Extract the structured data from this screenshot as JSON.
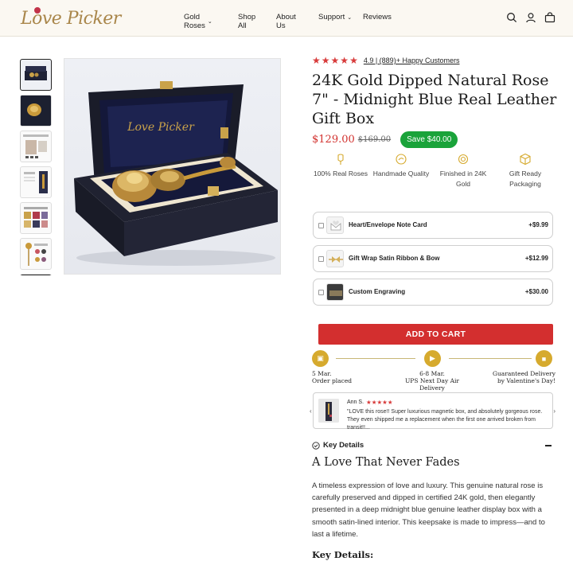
{
  "brand": {
    "logo_text": "Love Picker"
  },
  "nav": {
    "items": [
      {
        "label": "Gold Roses",
        "has_dropdown": true
      },
      {
        "label": "Shop All",
        "has_dropdown": false
      },
      {
        "label": "About Us",
        "has_dropdown": false
      },
      {
        "label": "Support",
        "has_dropdown": true
      },
      {
        "label": "Reviews",
        "has_dropdown": false
      }
    ],
    "icons": [
      "search-icon",
      "account-icon",
      "cart-icon"
    ]
  },
  "gallery": {
    "main_image": {
      "box_logo_text": "Love Picker"
    },
    "thumbnail_count": 7,
    "active_index": 0
  },
  "product": {
    "rating_value": "4.9",
    "rating_text": "4.9 | (889)+ Happy Customers",
    "star_count": 5,
    "title": "24K Gold Dipped Natural Rose 7\" - Midnight Blue Real Leather Gift Box",
    "price": "$129.00",
    "compare_price": "$169.00",
    "save_badge": "Save $40.00"
  },
  "features": [
    {
      "icon": "rose-icon",
      "label": "100% Real Roses"
    },
    {
      "icon": "handmade-icon",
      "label": "Handmade Quality"
    },
    {
      "icon": "gold-icon",
      "label": "Finished in 24K Gold"
    },
    {
      "icon": "gift-box-icon",
      "label": "Gift Ready Packaging"
    }
  ],
  "addons": [
    {
      "label": "Heart/Envelope Note Card",
      "price": "+$9.99",
      "checked": false
    },
    {
      "label": "Gift Wrap Satin Ribbon & Bow",
      "price": "+$12.99",
      "checked": false
    },
    {
      "label": "Custom Engraving",
      "price": "+$30.00",
      "checked": false
    }
  ],
  "add_to_cart": {
    "label": "ADD TO CART"
  },
  "delivery_timeline": [
    {
      "icon": "calendar-icon",
      "line1": "5 Mar.",
      "line2": "Order placed"
    },
    {
      "icon": "truck-icon",
      "line1": "6-8 Mar.",
      "line2": "UPS Next Day Air Delivery"
    },
    {
      "icon": "gift-icon",
      "line1": "Guaranteed Delivery",
      "line2": "by Valentine's Day!"
    }
  ],
  "review": {
    "author": "Ann S.",
    "stars": 5,
    "text": "\"LOVE this rose!! Super luxurious magnetic box, and absolutely gorgeous rose. They even shipped me a replacement when the first one arrived broken from transit!!..."
  },
  "key_details": {
    "label": "Key Details",
    "heading": "A Love That Never Fades",
    "description": "A timeless expression of love and luxury. This genuine natural rose is carefully preserved and dipped in certified 24K gold, then elegantly presented in a deep midnight blue genuine leather display box with a smooth satin-lined interior. This keepsake is made to impress—and to last a lifetime.",
    "subheading": "Key Details:"
  },
  "colors": {
    "accent_red": "#d32f2f",
    "star_red": "#d83b3b",
    "save_green": "#1aa33a",
    "gold": "#d6aa2e",
    "header_bg": "#fbf8f2"
  }
}
